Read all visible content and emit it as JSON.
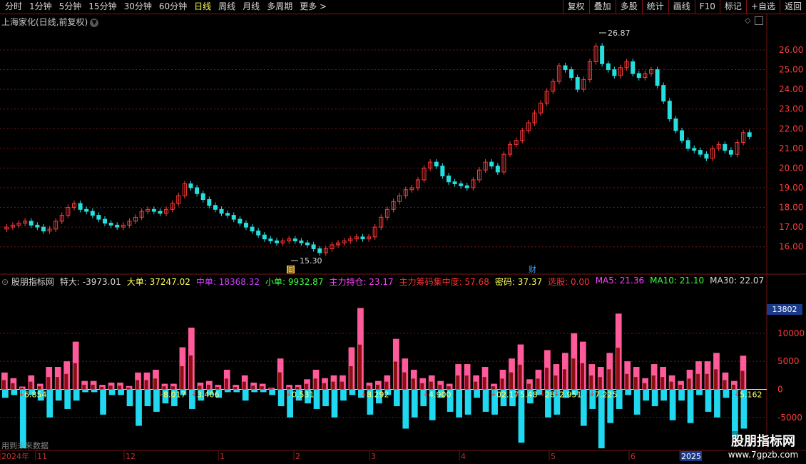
{
  "toolbar": {
    "periods": [
      "分时",
      "1分钟",
      "5分钟",
      "15分钟",
      "30分钟",
      "60分钟",
      "日线",
      "周线",
      "月线",
      "多周期",
      "更多 >"
    ],
    "active_period": "日线",
    "right_buttons": [
      "复权",
      "叠加",
      "多股",
      "统计",
      "画线",
      "F10",
      "标记",
      "+自选",
      "返回"
    ]
  },
  "chart_title": "上海家化(日线,前复权)",
  "colors": {
    "up": "#ff3b3b",
    "down": "#27dede",
    "grid": "#7a1515",
    "pink": "#ff5a9a",
    "cyan": "#20d8f0"
  },
  "chart_data": [
    {
      "type": "candlestick",
      "name": "上海家化(日线,前复权)",
      "y_ticks": [
        26.0,
        25.0,
        24.0,
        23.0,
        22.0,
        21.0,
        20.0,
        19.0,
        18.0,
        17.0,
        16.0
      ],
      "ylim": [
        15.3,
        26.87
      ],
      "annotations": [
        {
          "label": "26.87"
        },
        {
          "label": "15.30"
        }
      ],
      "markers": [
        "回",
        "财"
      ],
      "close": [
        17.0,
        17.1,
        17.2,
        17.3,
        17.1,
        17.0,
        16.8,
        16.9,
        17.3,
        17.6,
        18.0,
        18.2,
        17.9,
        17.8,
        17.6,
        17.4,
        17.2,
        17.1,
        17.0,
        17.1,
        17.3,
        17.5,
        17.8,
        17.9,
        17.8,
        17.7,
        17.9,
        18.2,
        18.6,
        19.2,
        19.0,
        18.7,
        18.4,
        18.1,
        17.9,
        17.7,
        17.6,
        17.4,
        17.2,
        17.0,
        16.8,
        16.6,
        16.4,
        16.3,
        16.2,
        16.3,
        16.4,
        16.3,
        16.2,
        16.1,
        15.9,
        15.7,
        15.9,
        16.1,
        16.2,
        16.3,
        16.4,
        16.5,
        16.4,
        16.5,
        17.0,
        17.5,
        17.9,
        18.3,
        18.6,
        18.9,
        19.0,
        19.4,
        20.0,
        20.3,
        20.1,
        19.6,
        19.3,
        19.2,
        19.1,
        19.0,
        19.4,
        19.9,
        20.3,
        20.1,
        19.8,
        20.7,
        21.2,
        21.4,
        21.9,
        22.3,
        22.8,
        23.3,
        23.9,
        24.4,
        25.2,
        25.0,
        24.6,
        24.0,
        24.5,
        25.4,
        26.2,
        25.3,
        25.0,
        24.7,
        25.1,
        25.4,
        24.8,
        24.6,
        24.8,
        25.0,
        24.2,
        23.4,
        22.5,
        21.9,
        21.4,
        21.0,
        20.9,
        20.7,
        20.5,
        21.0,
        21.2,
        20.9,
        20.7,
        21.3,
        21.8,
        21.6
      ]
    },
    {
      "type": "bar",
      "name": "股朋指标网",
      "y_ticks": [
        10000,
        5000,
        0,
        -5000
      ],
      "ylim": [
        -10500,
        18500
      ],
      "values_pink": [
        3000,
        2000,
        500,
        2500,
        1000,
        4000,
        4000,
        5000,
        8500,
        1500,
        1500,
        800,
        1200,
        1200,
        600,
        3000,
        3000,
        3500,
        1000,
        1000,
        7500,
        11000,
        1200,
        1500,
        800,
        3500,
        800,
        2500,
        1200,
        1000,
        300,
        5500,
        800,
        800,
        1800,
        3500,
        2000,
        2500,
        2500,
        7500,
        14500,
        1200,
        1500,
        2500,
        9000,
        5500,
        3500,
        2000,
        2500,
        1500,
        1000,
        4500,
        4500,
        2500,
        4000,
        1000,
        3500,
        5500,
        8000,
        1800,
        3500,
        7000,
        4500,
        6500,
        10000,
        8500,
        4500,
        4000,
        6500,
        13500,
        5000,
        4000,
        2000,
        4500,
        4000,
        2500,
        1500,
        3500,
        5000,
        5000,
        6500,
        3000,
        1500,
        6000
      ],
      "values_cyan": [
        -1500,
        -1000,
        -10500,
        -1000,
        -2000,
        -5000,
        -2000,
        -3500,
        -2000,
        -500,
        -500,
        -4500,
        -1000,
        -1000,
        -3000,
        -6500,
        -3000,
        -4000,
        -2500,
        -3000,
        -1000,
        -3500,
        -2000,
        -1000,
        -1500,
        -500,
        -500,
        -2000,
        -500,
        -500,
        -1000,
        -3000,
        -5000,
        -2000,
        -2500,
        -3500,
        -3000,
        -5000,
        -2000,
        -1000,
        -1500,
        -4500,
        -2500,
        -1000,
        -3000,
        -7000,
        -5000,
        -3000,
        -5500,
        -1500,
        -4000,
        -5000,
        -4500,
        -1500,
        -4000,
        -4500,
        -3000,
        -3000,
        -9500,
        -2500,
        -1000,
        -5000,
        -4500,
        -1500,
        -1000,
        -6500,
        -3500,
        -10500,
        -6000,
        -3500,
        -1000,
        -4500,
        -2000,
        -3000,
        -2000,
        -5500,
        -2000,
        -6000,
        -1000,
        -4000,
        -5000,
        -1500,
        -8500,
        -7000
      ],
      "labels": [
        "6.854",
        "8.017",
        "3.406",
        "0.531",
        "8.292",
        "4.900",
        "02.17",
        "5.48",
        "28",
        "2.951",
        "7.225",
        "5.162"
      ]
    }
  ],
  "indicator": {
    "name": "股朋指标网",
    "fields": [
      {
        "label": "特大: -3973.01",
        "color": "#d8d8d8"
      },
      {
        "label": "大单: 37247.02",
        "color": "#ffff55"
      },
      {
        "label": "中单: 18368.32",
        "color": "#d040ff"
      },
      {
        "label": "小单: 9932.87",
        "color": "#40ff40"
      },
      {
        "label": "主力持仓: 23.17",
        "color": "#ff40ff"
      },
      {
        "label": "主力筹码集中度: 57.68",
        "color": "#ff3030"
      },
      {
        "label": "密码: 37.37",
        "color": "#ffff55"
      },
      {
        "label": "选股: 0.00",
        "color": "#ff3030"
      },
      {
        "label": "MA5: 21.36",
        "color": "#ff40ff"
      },
      {
        "label": "MA10: 21.10",
        "color": "#40ff40"
      },
      {
        "label": "MA30: 22.07",
        "color": "#d8d8d8"
      }
    ]
  },
  "sub_box": "13802",
  "future_text": "用到未来数据",
  "x_labels": [
    "2024年",
    "11",
    "12",
    "1",
    "2",
    "3",
    "4",
    "5",
    "6",
    "2025"
  ],
  "watermark": {
    "title": "股朋指标网",
    "url": "www.7gpzb.com"
  }
}
